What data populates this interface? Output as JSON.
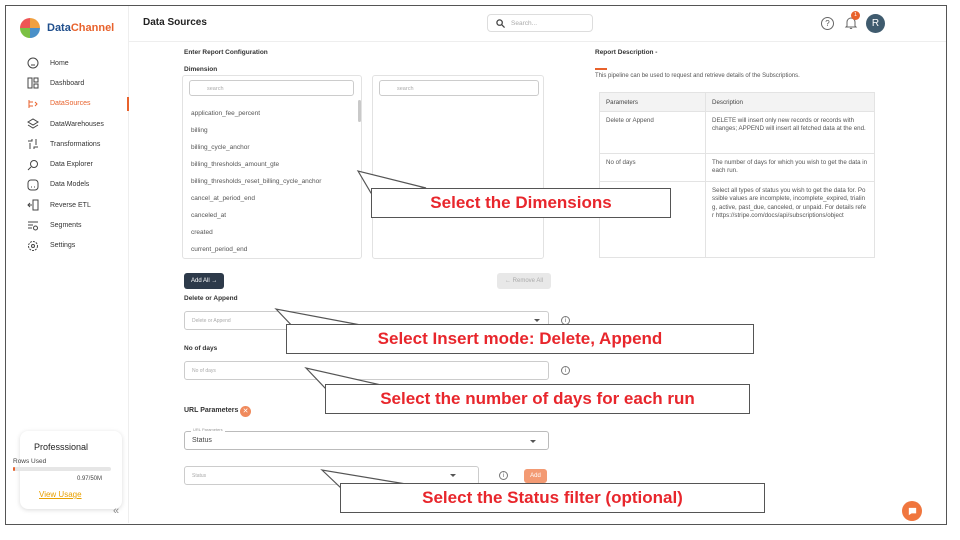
{
  "app": {
    "brand_a": "Data",
    "brand_b": "Channel",
    "page_title": "Data Sources"
  },
  "search": {
    "placeholder": "Search..."
  },
  "header": {
    "help": "?",
    "notifications": "1",
    "avatar": "R"
  },
  "sidebar": {
    "items": [
      {
        "label": "Home",
        "icon": "home-icon"
      },
      {
        "label": "Dashboard",
        "icon": "dashboard-icon"
      },
      {
        "label": "DataSources",
        "icon": "datasources-icon",
        "active": true
      },
      {
        "label": "DataWarehouses",
        "icon": "warehouse-icon"
      },
      {
        "label": "Transformations",
        "icon": "transform-icon"
      },
      {
        "label": "Data Explorer",
        "icon": "explorer-icon"
      },
      {
        "label": "Data Models",
        "icon": "models-icon"
      },
      {
        "label": "Reverse ETL",
        "icon": "reverse-etl-icon"
      },
      {
        "label": "Segments",
        "icon": "segments-icon"
      },
      {
        "label": "Settings",
        "icon": "settings-icon"
      }
    ]
  },
  "plan": {
    "title": "Professsional",
    "rows_label": "Rows Used",
    "used": "0.97/50M",
    "usage_fraction": 0.02,
    "link": "View Usage"
  },
  "config": {
    "title": "Enter Report Configuration",
    "dimension_label": "Dimension",
    "left_search_placeholder": "search",
    "right_search_placeholder": "search",
    "dimensions": [
      "application_fee_percent",
      "billing",
      "billing_cycle_anchor",
      "billing_thresholds_amount_gte",
      "billing_thresholds_reset_billing_cycle_anchor",
      "cancel_at_period_end",
      "canceled_at",
      "created",
      "current_period_end"
    ],
    "add_all": "Add All →",
    "remove_all": "← Remove All"
  },
  "report": {
    "title": "Report Description -",
    "description": "This pipeline can be used to request and retrieve details of the Subscriptions.",
    "table_headers": [
      "Parameters",
      "Description"
    ],
    "rows": [
      {
        "param": "Delete or Append",
        "desc": "DELETE will insert only new records or records with changes; APPEND will insert all fetched data at the end."
      },
      {
        "param": "No of days",
        "desc": "The number of days for which you wish to get the data in each run."
      },
      {
        "param": "",
        "desc": "Select all types of status you wish to get the data for. Possible values are incomplete, incomplete_expired, trialing, active, past_due, canceled, or unpaid. For details refer https://stripe.com/docs/api/subscriptions/object"
      }
    ]
  },
  "fields": {
    "delete_append_label": "Delete or Append",
    "delete_append_placeholder": "Delete or Append",
    "days_label": "No of days",
    "days_placeholder": "No of days",
    "url_label": "URL Parameters",
    "url_float": "URL Parameters",
    "status_value": "Status",
    "status_placeholder": "Status",
    "add_button": "Add"
  },
  "callouts": {
    "dimensions": "Select the Dimensions",
    "insert_mode": "Select Insert mode: Delete, Append",
    "days": "Select the number of days for each run",
    "status": "Select the Status filter (optional)"
  },
  "colors": {
    "accent": "#e8622c",
    "callout_text": "#e8262c",
    "add_all_bg": "#2d3a4a"
  }
}
